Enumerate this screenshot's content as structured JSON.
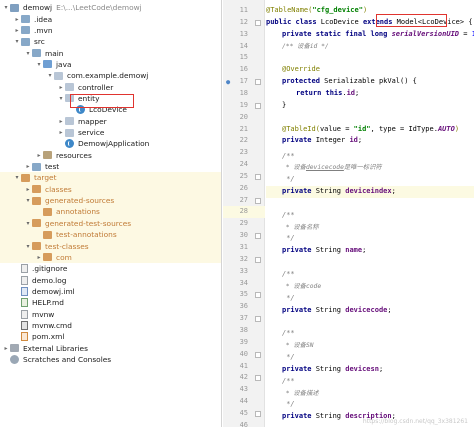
{
  "project_tree": {
    "items": [
      {
        "label": "demowj",
        "path_hint": "E:\\...\\LeetCode\\demowj",
        "arrow": "down",
        "icon": "module-folder-icon"
      },
      {
        "label": ".idea",
        "arrow": "right",
        "icon": "folder-icon"
      },
      {
        "label": ".mvn",
        "arrow": "right",
        "icon": "folder-icon"
      },
      {
        "label": "src",
        "arrow": "down",
        "icon": "folder-icon"
      },
      {
        "label": "main",
        "arrow": "down",
        "icon": "folder-icon"
      },
      {
        "label": "java",
        "arrow": "down",
        "icon": "source-folder-icon"
      },
      {
        "label": "com.example.demowj",
        "arrow": "down",
        "icon": "package-icon"
      },
      {
        "label": "controller",
        "arrow": "right",
        "icon": "package-icon"
      },
      {
        "label": "entity",
        "arrow": "down",
        "icon": "package-icon"
      },
      {
        "label": "LcoDevice",
        "arrow": "",
        "icon": "class-icon"
      },
      {
        "label": "mapper",
        "arrow": "right",
        "icon": "package-icon"
      },
      {
        "label": "service",
        "arrow": "right",
        "icon": "package-icon"
      },
      {
        "label": "DemowjApplication",
        "arrow": "",
        "icon": "class-icon"
      },
      {
        "label": "resources",
        "arrow": "right",
        "icon": "resources-folder-icon"
      },
      {
        "label": "test",
        "arrow": "right",
        "icon": "folder-icon"
      },
      {
        "label": "target",
        "arrow": "down",
        "icon": "excluded-folder-icon"
      },
      {
        "label": "classes",
        "arrow": "right",
        "icon": "excluded-folder-icon"
      },
      {
        "label": "generated-sources",
        "arrow": "down",
        "icon": "excluded-folder-icon"
      },
      {
        "label": "annotations",
        "arrow": "",
        "icon": "excluded-folder-icon"
      },
      {
        "label": "generated-test-sources",
        "arrow": "down",
        "icon": "excluded-folder-icon"
      },
      {
        "label": "test-annotations",
        "arrow": "",
        "icon": "excluded-folder-icon"
      },
      {
        "label": "test-classes",
        "arrow": "down",
        "icon": "excluded-folder-icon"
      },
      {
        "label": "com",
        "arrow": "right",
        "icon": "excluded-folder-icon"
      },
      {
        "label": ".gitignore",
        "arrow": "",
        "icon": "file-icon"
      },
      {
        "label": "demo.log",
        "arrow": "",
        "icon": "file-icon"
      },
      {
        "label": "demowj.iml",
        "arrow": "",
        "icon": "iml-file-icon"
      },
      {
        "label": "HELP.md",
        "arrow": "",
        "icon": "markdown-file-icon"
      },
      {
        "label": "mvnw",
        "arrow": "",
        "icon": "file-icon"
      },
      {
        "label": "mvnw.cmd",
        "arrow": "",
        "icon": "cmd-file-icon"
      },
      {
        "label": "pom.xml",
        "arrow": "",
        "icon": "xml-file-icon"
      },
      {
        "label": "External Libraries",
        "arrow": "right",
        "icon": "libraries-icon"
      },
      {
        "label": "Scratches and Consoles",
        "arrow": "",
        "icon": "scratches-icon"
      }
    ],
    "selected": "LcoDevice"
  },
  "editor": {
    "line_numbers": [
      "11",
      "12",
      "13",
      "14",
      "15",
      "16",
      "17",
      "18",
      "19",
      "20",
      "21",
      "22",
      "23",
      "24",
      "25",
      "26",
      "27",
      "28",
      "29",
      "30",
      "31",
      "32",
      "33",
      "34",
      "35",
      "36",
      "37",
      "38",
      "39",
      "40",
      "41",
      "42",
      "43",
      "44",
      "45",
      "46"
    ],
    "highlighted_line": "28",
    "code": {
      "l11_ann": "@TableName(",
      "l11_str": "\"cfg_device\"",
      "l11_end": ")",
      "l12_kw": "public class ",
      "l12_name": "LcoDevice ",
      "l12_kw2": "extends ",
      "l12_model": "Model<LcoDevice>",
      "l12_end": " {",
      "l13_kw": "private static final long ",
      "l13_fld": "serialVersionUID",
      "l13_mid": " = ",
      "l13_num": "1L",
      "l13_end": ";",
      "l14_cm": "/** 设备id */",
      "l16_ann": "@Override",
      "l17_kw": "protected ",
      "l17_rest": "Serializable pkVal() {",
      "l18_kw": "return this",
      "l18_dot": ".",
      "l18_fld": "id",
      "l18_end": ";",
      "l19": "}",
      "l21_ann": "@TableId(",
      "l21_a": "value = ",
      "l21_str": "\"id\"",
      "l21_b": ", type = IdType.",
      "l21_ital": "AUTO",
      "l21_end": ")",
      "l22_kw": "private ",
      "l22_type": "Integer ",
      "l22_fld": "id",
      "l22_end": ";",
      "l25_open": "/**",
      "l26_pre": " * 设备",
      "l26_under": "devicecode",
      "l26_post": "是唯一标识符",
      "l27_close": " */",
      "l28_kw": "private ",
      "l28_type": "String ",
      "l28_fld": "deviceindex",
      "l28_end": ";",
      "l30_open": "/**",
      "l31_text": " * 设备名称",
      "l32_close": " */",
      "l33_kw": "private ",
      "l33_type": "String ",
      "l33_fld": "name",
      "l33_end": ";",
      "l35_open": "/**",
      "l36_text": " * 设备code",
      "l37_close": " */",
      "l38_kw": "private ",
      "l38_type": "String ",
      "l38_fld": "devicecode",
      "l38_end": ";",
      "l40_open": "/**",
      "l41_text": " * 设备SN",
      "l42_close": " */",
      "l43_kw": "private ",
      "l43_type": "String ",
      "l43_fld": "devicesn",
      "l43_end": ";",
      "l45_open": "/**",
      "l46_text": " * 设备描述",
      "l47_close": " */",
      "l48_kw": "private ",
      "l48_type": "String ",
      "l48_fld": "description",
      "l48_end": ";"
    }
  },
  "watermark": "https://blog.csdn.net/qq_3x381261",
  "colors": {
    "highlight_box": "#e0342f",
    "selection_bg": "#fdf9e3"
  }
}
